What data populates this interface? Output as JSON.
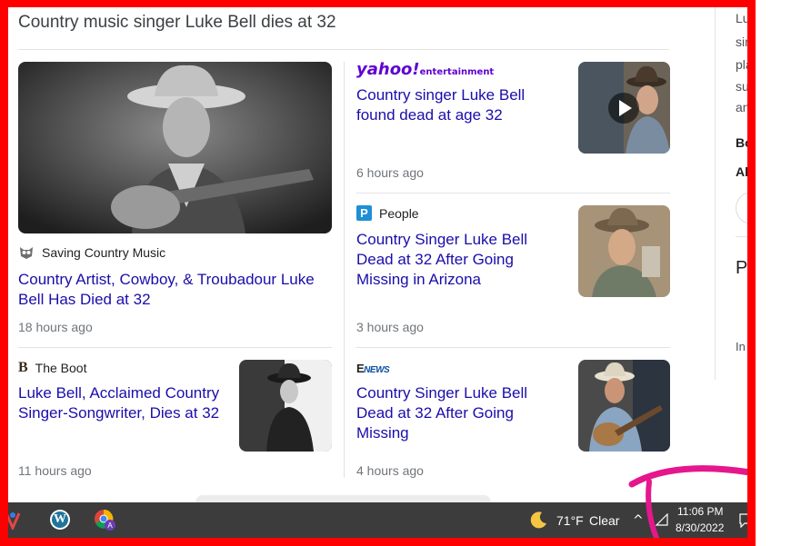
{
  "section_title": "Country music singer Luke Bell dies at 32",
  "articles": [
    {
      "source": "Saving Country Music",
      "title": "Country Artist, Cowboy, & Troubadour Luke Bell Has Died at 32",
      "time": "18 hours ago"
    },
    {
      "source": "The Boot",
      "title": "Luke Bell, Acclaimed Country Singer-Songwriter, Dies at 32",
      "time": "11 hours ago"
    },
    {
      "source_logo_main": "yahoo!",
      "source_logo_sub": "entertainment",
      "title": "Country singer Luke Bell found dead at age 32",
      "time": "6 hours ago"
    },
    {
      "source": "People",
      "title": "Country Singer Luke Bell Dead at 32 After Going Missing in Arizona",
      "time": "3 hours ago"
    },
    {
      "source_logo_main": "E",
      "source_logo_sub": "NEWS",
      "title": "Country Singer Luke Bell Dead at 32 After Going Missing",
      "time": "4 hours ago"
    }
  ],
  "right_panel": {
    "lines": [
      "Lu",
      "sin",
      "pla",
      "su",
      "an"
    ],
    "bold": [
      "Bo",
      "Al"
    ],
    "heading": "P",
    "small": "In"
  },
  "taskbar": {
    "weather_temp": "71°F",
    "weather_cond": "Clear",
    "time": "11:06 PM",
    "date": "8/30/2022",
    "icons": [
      "tools-icon",
      "wordpress-icon",
      "chrome-icon"
    ]
  },
  "colors": {
    "frame": "#ff0000",
    "link": "#1a0dab",
    "annotation": "#e5178c",
    "taskbar": "#3c3c3c"
  }
}
